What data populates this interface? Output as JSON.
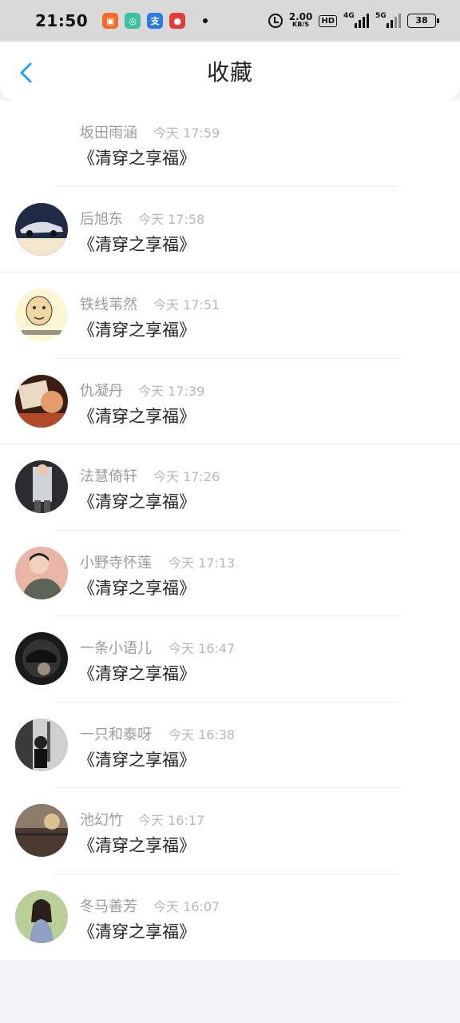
{
  "status_bar": {
    "time": "21:50",
    "speed_value": "2.00",
    "speed_unit": "KB/S",
    "hd": "HD",
    "sig1": "4G",
    "sig2": "5G",
    "battery": "38"
  },
  "header": {
    "title": "收藏"
  },
  "items": [
    {
      "name": "坂田雨涵",
      "time": "今天 17:59",
      "book": "《清穿之享福》",
      "avatar": "none"
    },
    {
      "name": "后旭东",
      "time": "今天 17:58",
      "book": "《清穿之享福》",
      "avatar": "car"
    },
    {
      "name": "铁线苇然",
      "time": "今天 17:51",
      "book": "《清穿之享福》",
      "avatar": "meme"
    },
    {
      "name": "仇凝丹",
      "time": "今天 17:39",
      "book": "《清穿之享福》",
      "avatar": "birthday"
    },
    {
      "name": "法慧倚轩",
      "time": "今天 17:26",
      "book": "《清穿之享福》",
      "avatar": "person-dark"
    },
    {
      "name": "小野寺怀莲",
      "time": "今天 17:13",
      "book": "《清穿之享福》",
      "avatar": "person-pink"
    },
    {
      "name": "一条小语儿",
      "time": "今天 16:47",
      "book": "《清穿之享福》",
      "avatar": "helmet"
    },
    {
      "name": "一只和泰呀",
      "time": "今天 16:38",
      "book": "《清穿之享福》",
      "avatar": "street-bw"
    },
    {
      "name": "池幻竹",
      "time": "今天 16:17",
      "book": "《清穿之享福》",
      "avatar": "sunset"
    },
    {
      "name": "冬马善芳",
      "time": "今天 16:07",
      "book": "《清穿之享福》",
      "avatar": "girl-green"
    }
  ]
}
